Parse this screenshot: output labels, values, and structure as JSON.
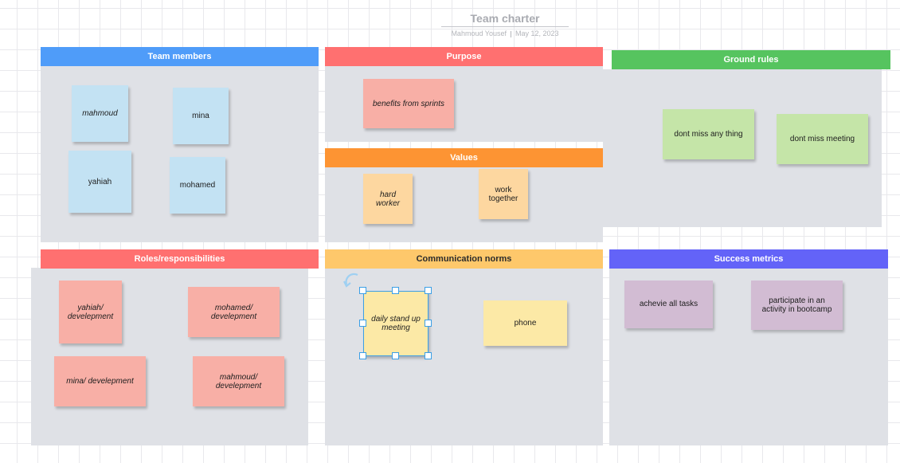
{
  "board": {
    "title": "Team charter",
    "author": "Mahmoud Yousef",
    "date": "May 12, 2023"
  },
  "colors": {
    "team_members": "#4f9cf9",
    "purpose": "#ff7070",
    "values": "#fd9433",
    "ground_rules": "#56c45f",
    "roles": "#ff7070",
    "communication": "#fec86b",
    "success": "#6363f8",
    "selection": "#3b9fe6"
  },
  "panels": {
    "team_members": {
      "title": "Team members",
      "notes": [
        "mahmoud",
        "mina",
        "yahiah",
        "mohamed"
      ]
    },
    "purpose": {
      "title": "Purpose",
      "notes": [
        "benefits from sprints"
      ]
    },
    "values": {
      "title": "Values",
      "notes": [
        "hard worker",
        "work together"
      ]
    },
    "ground_rules": {
      "title": "Ground rules",
      "notes": [
        "dont miss any thing",
        "dont miss meeting"
      ]
    },
    "roles": {
      "title": "Roles/responsibilities",
      "notes": [
        "yahiah/ develepment",
        "mohamed/ develepment",
        "mina/ develepment",
        "mahmoud/ develepment"
      ]
    },
    "communication": {
      "title": "Communication norms",
      "notes": [
        "daily stand up meeting",
        "phone"
      ]
    },
    "success": {
      "title": "Success metrics",
      "notes": [
        "achevie all tasks",
        "participate in an activity in bootcamp"
      ]
    }
  },
  "icons": {
    "rotate": "rotate-handle-icon"
  }
}
